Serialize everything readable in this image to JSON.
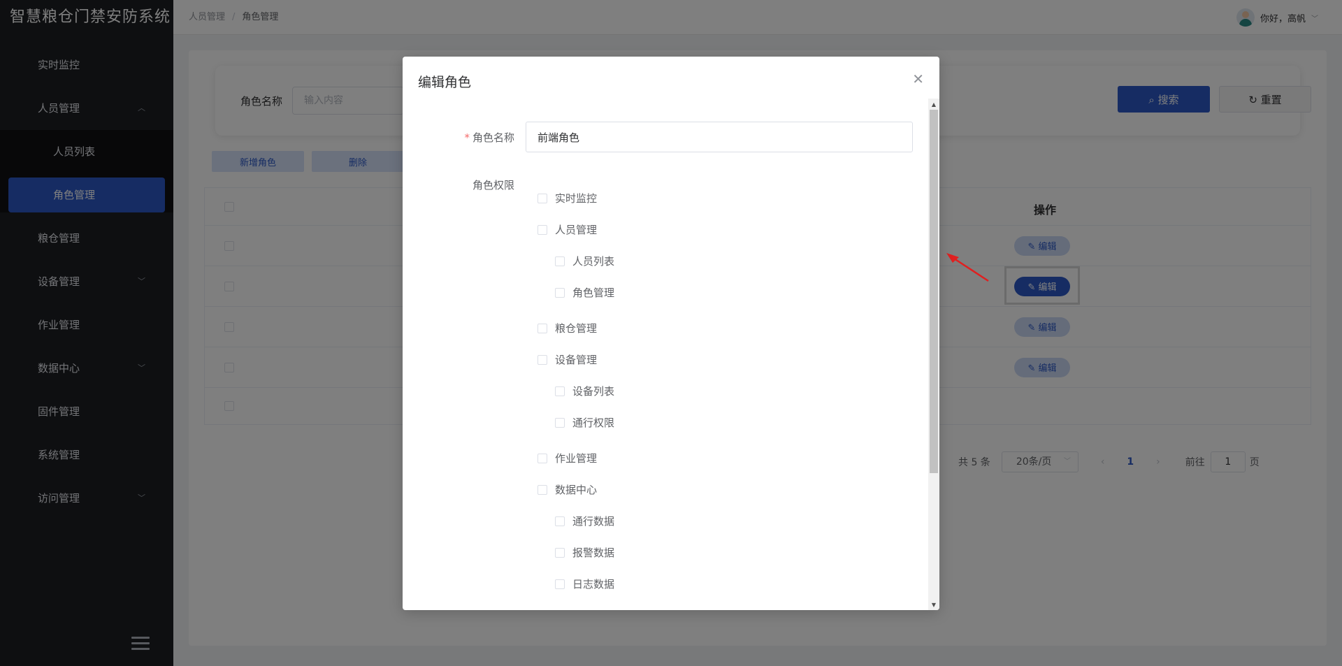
{
  "app": {
    "title": "智慧粮仓门禁安防系统"
  },
  "sidebar": {
    "items": [
      {
        "label": "实时监控"
      },
      {
        "label": "人员管理"
      },
      {
        "label": "人员列表"
      },
      {
        "label": "角色管理"
      },
      {
        "label": "粮仓管理"
      },
      {
        "label": "设备管理"
      },
      {
        "label": "作业管理"
      },
      {
        "label": "数据中心"
      },
      {
        "label": "固件管理"
      },
      {
        "label": "系统管理"
      },
      {
        "label": "访问管理"
      }
    ]
  },
  "breadcrumb": {
    "parent": "人员管理",
    "sep": "/",
    "current": "角色管理"
  },
  "user": {
    "greeting": "你好，高帆"
  },
  "search": {
    "label": "角色名称",
    "placeholder": "输入内容",
    "search_btn": "搜索",
    "reset_btn": "重置"
  },
  "toolbar": {
    "new_btn": "新增角色",
    "delete_btn": "删除"
  },
  "table": {
    "op_header": "操作",
    "edit_label": "编辑"
  },
  "pagination": {
    "total": "共 5 条",
    "page_size": "20条/页",
    "current_page": "1",
    "goto_label": "前往",
    "goto_value": "1",
    "page_unit": "页"
  },
  "dialog": {
    "title": "编辑角色",
    "name_label": "角色名称",
    "name_value": "前端角色",
    "perm_label": "角色权限",
    "permissions": [
      {
        "label": "实时监控"
      },
      {
        "label": "人员管理"
      },
      {
        "label": "人员列表"
      },
      {
        "label": "角色管理"
      },
      {
        "label": "粮仓管理"
      },
      {
        "label": "设备管理"
      },
      {
        "label": "设备列表"
      },
      {
        "label": "通行权限"
      },
      {
        "label": "作业管理"
      },
      {
        "label": "数据中心"
      },
      {
        "label": "通行数据"
      },
      {
        "label": "报警数据"
      },
      {
        "label": "日志数据"
      }
    ]
  },
  "colors": {
    "primary": "#2c59c6",
    "sidebar_bg": "#1d1e23",
    "required": "#f56c6c"
  }
}
